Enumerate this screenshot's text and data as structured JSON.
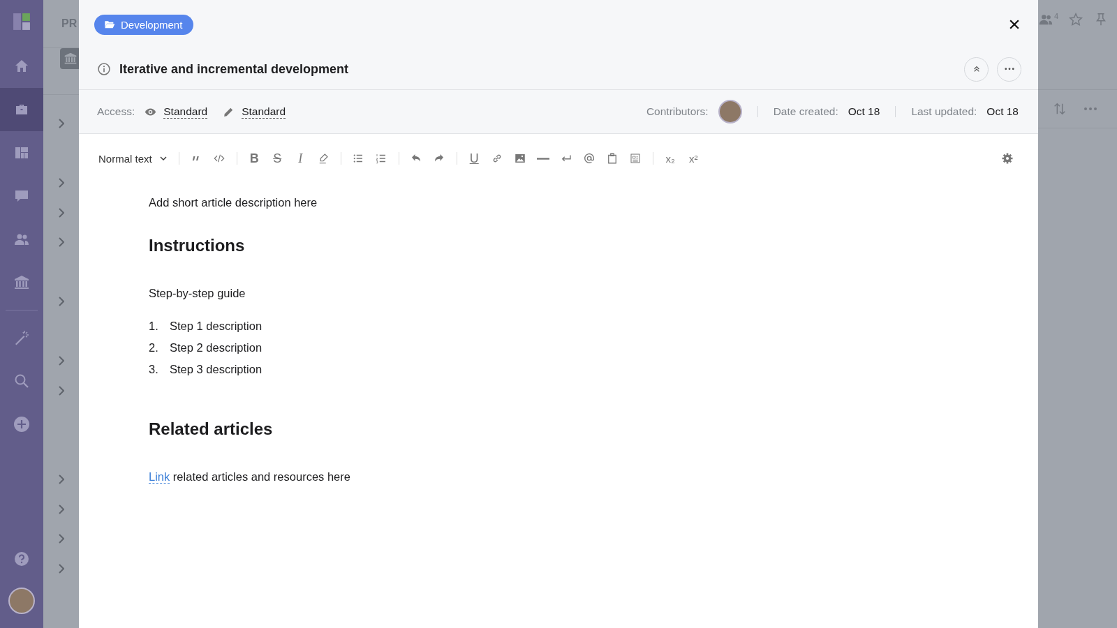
{
  "nav": {
    "items": [
      {
        "selected": false
      },
      {
        "selected": true
      },
      {
        "selected": false
      },
      {
        "selected": false
      },
      {
        "selected": false
      },
      {
        "selected": false
      },
      {
        "selected": false
      },
      {
        "selected": false
      },
      {
        "selected": false
      }
    ]
  },
  "backdrop": {
    "heading": "PR",
    "members_count": "4"
  },
  "modal": {
    "folder": "Development",
    "title": "Iterative and incremental development",
    "access": {
      "label": "Access:",
      "view": "Standard",
      "edit": "Standard"
    },
    "contributors_label": "Contributors:",
    "date_created_label": "Date created:",
    "date_created": "Oct 18",
    "last_updated_label": "Last updated:",
    "last_updated": "Oct 18"
  },
  "toolbar": {
    "style": "Normal text",
    "groups": [
      [
        {
          "kind": "icon"
        },
        {
          "kind": "icon"
        }
      ],
      [
        {
          "kind": "bold",
          "label": "B"
        },
        {
          "kind": "strike",
          "label": "S"
        },
        {
          "kind": "italic",
          "label": "I"
        },
        {
          "kind": "icon"
        }
      ],
      [
        {
          "kind": "icon"
        },
        {
          "kind": "icon"
        }
      ],
      [
        {
          "kind": "icon"
        },
        {
          "kind": "icon"
        }
      ],
      [
        {
          "kind": "underline",
          "label": "U"
        },
        {
          "kind": "icon"
        },
        {
          "kind": "icon"
        },
        {
          "kind": "icon"
        },
        {
          "kind": "icon"
        },
        {
          "kind": "icon"
        },
        {
          "kind": "icon"
        },
        {
          "kind": "icon"
        }
      ],
      [
        {
          "kind": "plain",
          "label": "x₂"
        },
        {
          "kind": "plain",
          "label": "x²"
        }
      ]
    ]
  },
  "document": [
    {
      "kind": "paragraph",
      "text": "Add short article description here"
    },
    {
      "kind": "heading",
      "text": "Instructions"
    },
    {
      "kind": "paragraph",
      "text": "Step-by-step guide"
    },
    {
      "kind": "list",
      "items": [
        {
          "number": "1.",
          "text": "Step 1 description"
        },
        {
          "number": "2.",
          "text": "Step 2 description"
        },
        {
          "number": "3.",
          "text": "Step 3 description"
        }
      ]
    },
    {
      "kind": "heading",
      "text": "Related articles"
    },
    {
      "kind": "linkline",
      "link": "Link",
      "text": "related articles and resources here"
    }
  ]
}
